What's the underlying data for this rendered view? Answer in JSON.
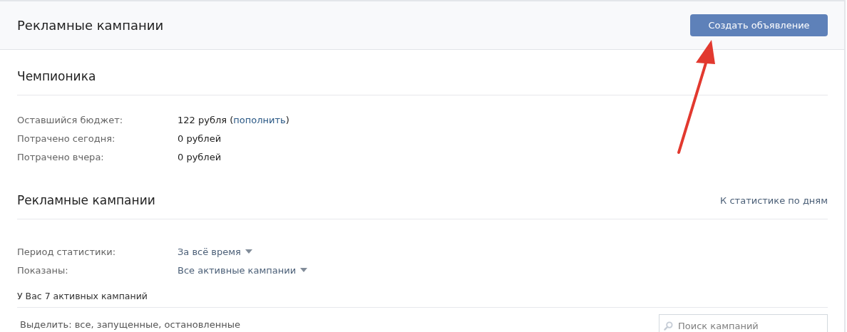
{
  "header": {
    "title": "Рекламные кампании",
    "button": "Создать объявление"
  },
  "account": {
    "title": "Чемпионика",
    "rows": [
      {
        "label": "Оставшийся бюджет:",
        "value": "122 рубля",
        "open": "(",
        "link": "пополнить",
        "close": ")"
      },
      {
        "label": "Потрачено сегодня:",
        "value": "0 рублей"
      },
      {
        "label": "Потрачено вчера:",
        "value": "0 рублей"
      }
    ]
  },
  "campaigns": {
    "title": "Рекламные кампании",
    "link": "К статистике по дням",
    "filters": [
      {
        "label": "Период статистики:",
        "value": "За всё время"
      },
      {
        "label": "Показаны:",
        "value": "Все активные кампании"
      }
    ],
    "count": "У Вас 7 активных кампаний",
    "select": "Выделить: все, запущенные, остановленные",
    "search": {
      "placeholder": "Поиск кампаний"
    }
  },
  "annotation": {
    "kind": "arrow"
  }
}
